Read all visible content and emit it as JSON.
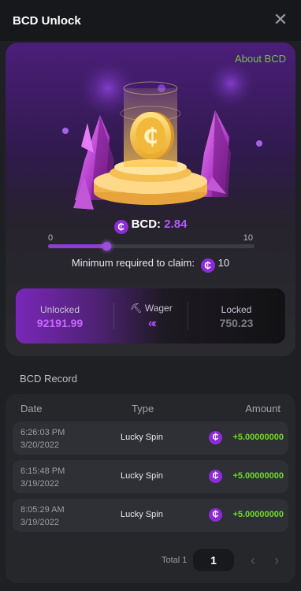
{
  "header": {
    "title": "BCD Unlock",
    "close_icon": "close-icon"
  },
  "hero": {
    "about_link": "About BCD",
    "bcd_label": "BCD:",
    "bcd_value": "2.84",
    "coin_glyph": "₵",
    "range_min": "0",
    "range_max": "10",
    "progress_fraction": 0.284,
    "min_claim_label": "Minimum required to claim:",
    "min_claim_value": "10"
  },
  "stats": {
    "unlocked_label": "Unlocked",
    "unlocked_value": "92191.99",
    "wager_label": "Wager",
    "wager_icon": "pickaxe-icon",
    "locked_label": "Locked",
    "locked_value": "750.23"
  },
  "record": {
    "title": "BCD Record",
    "columns": {
      "date": "Date",
      "type": "Type",
      "amount": "Amount"
    },
    "rows": [
      {
        "time": "6:26:03 PM",
        "date": "3/20/2022",
        "type": "Lucky Spin",
        "amount": "+5.00000000"
      },
      {
        "time": "6:15:48 PM",
        "date": "3/19/2022",
        "type": "Lucky Spin",
        "amount": "+5.00000000"
      },
      {
        "time": "8:05:29 AM",
        "date": "3/19/2022",
        "type": "Lucky Spin",
        "amount": "+5.00000000"
      }
    ],
    "pagination": {
      "total_label": "Total 1",
      "current_page": "1",
      "prev_icon": "chevron-left-icon",
      "next_icon": "chevron-right-icon"
    }
  },
  "colors": {
    "accent_purple": "#b657ff",
    "link_green": "#74c23b",
    "amount_green": "#6ddb2c",
    "background": "#1f2023"
  }
}
